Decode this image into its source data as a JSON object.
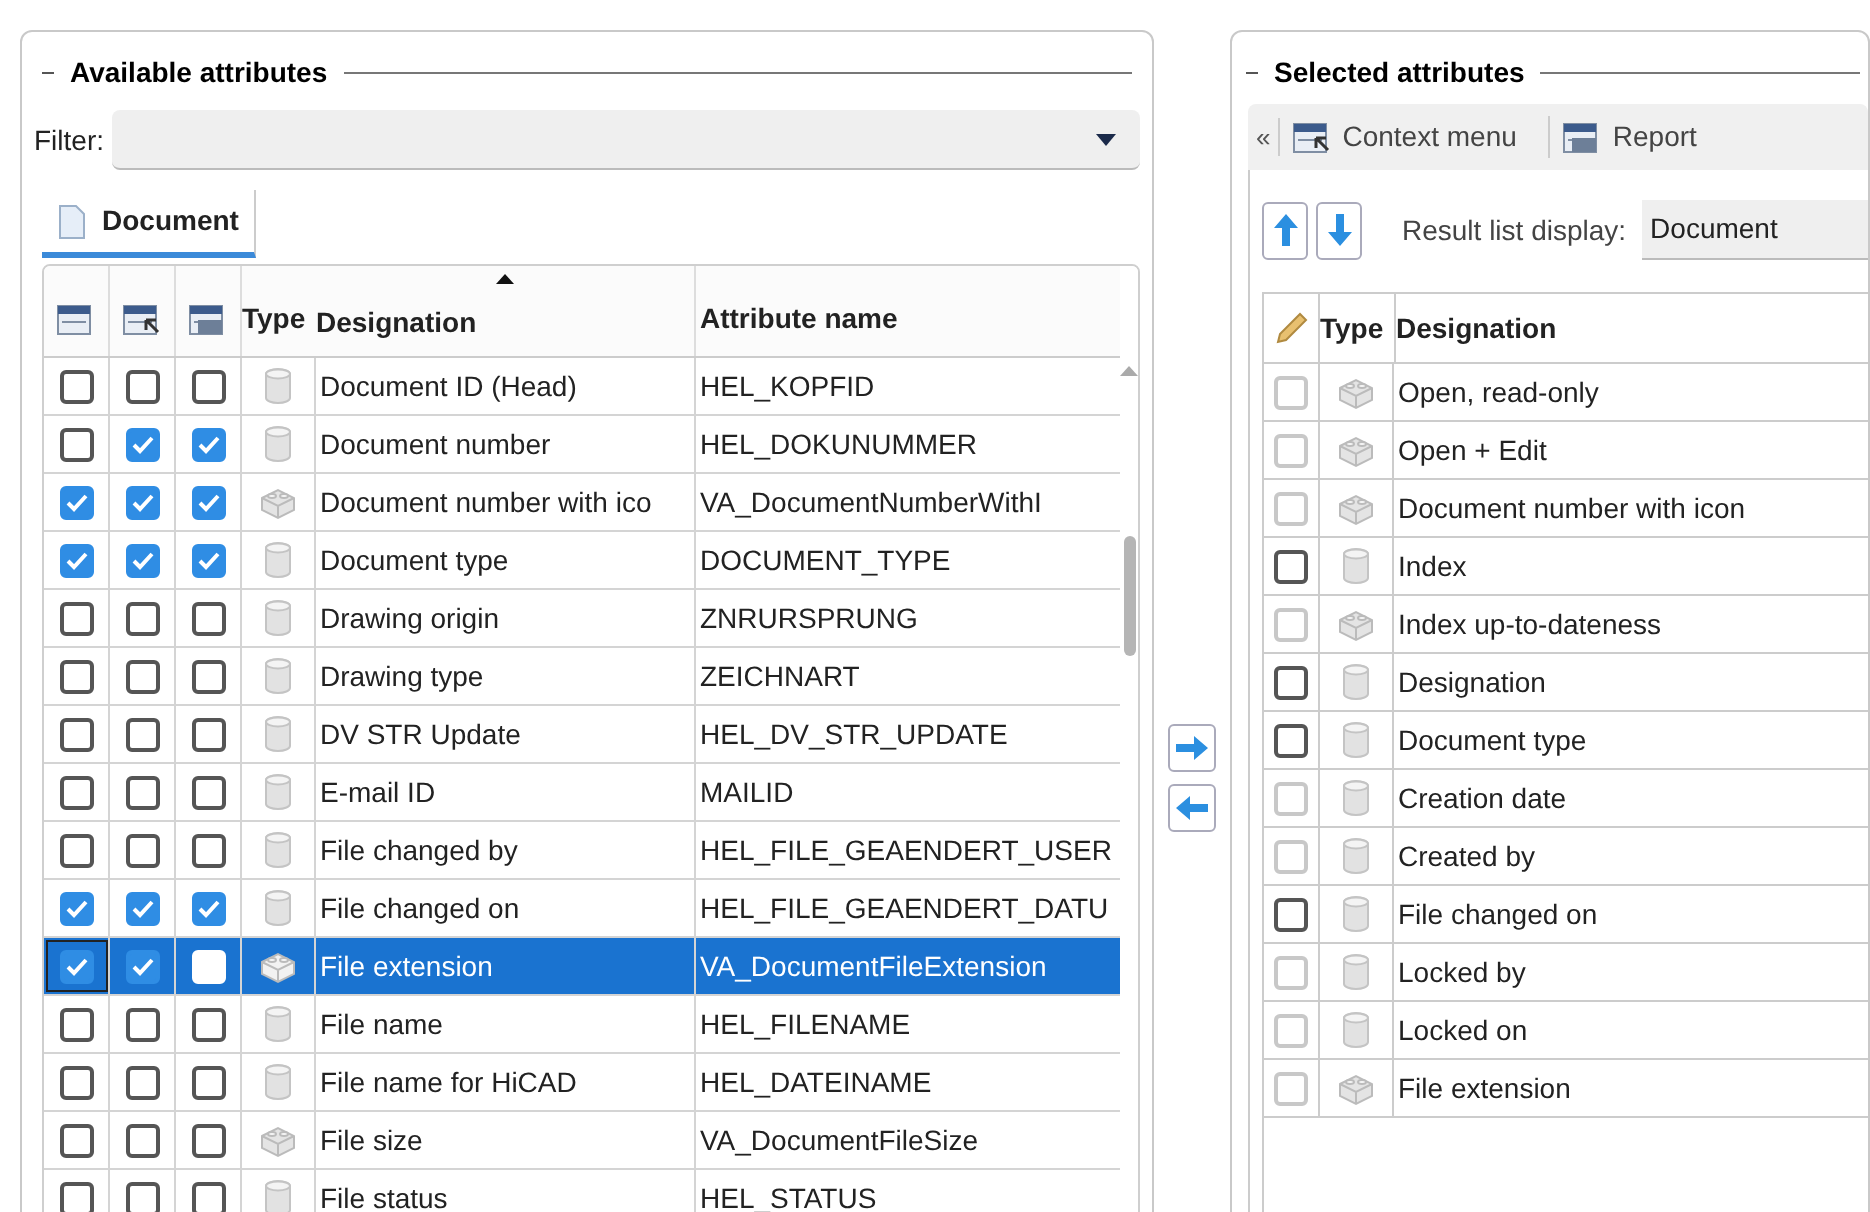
{
  "available": {
    "legend": "Available attributes",
    "filter": {
      "label": "Filter:"
    },
    "tab": {
      "label": "Document",
      "selected": true
    },
    "columns": [
      "Type",
      "Designation",
      "Attribute name"
    ],
    "rows": [
      {
        "display": false,
        "context": false,
        "report": false,
        "kind": "field",
        "designation": "Document ID (Head)",
        "attribute": "HEL_KOPFID",
        "selected": false
      },
      {
        "display": false,
        "context": true,
        "report": true,
        "kind": "field",
        "designation": "Document number",
        "attribute": "HEL_DOKUNUMMER",
        "selected": false
      },
      {
        "display": true,
        "context": true,
        "report": true,
        "kind": "virtual",
        "designation": "Document number with ico",
        "attribute": "VA_DocumentNumberWithI",
        "selected": false
      },
      {
        "display": true,
        "context": true,
        "report": true,
        "kind": "field",
        "designation": "Document type",
        "attribute": "DOCUMENT_TYPE",
        "selected": false
      },
      {
        "display": false,
        "context": false,
        "report": false,
        "kind": "field",
        "designation": "Drawing origin",
        "attribute": "ZNRURSPRUNG",
        "selected": false
      },
      {
        "display": false,
        "context": false,
        "report": false,
        "kind": "field",
        "designation": "Drawing type",
        "attribute": "ZEICHNART",
        "selected": false
      },
      {
        "display": false,
        "context": false,
        "report": false,
        "kind": "field",
        "designation": "DV STR Update",
        "attribute": "HEL_DV_STR_UPDATE",
        "selected": false
      },
      {
        "display": false,
        "context": false,
        "report": false,
        "kind": "field",
        "designation": "E-mail ID",
        "attribute": "MAILID",
        "selected": false
      },
      {
        "display": false,
        "context": false,
        "report": false,
        "kind": "field",
        "designation": "File changed by",
        "attribute": "HEL_FILE_GEAENDERT_USER",
        "selected": false
      },
      {
        "display": true,
        "context": true,
        "report": true,
        "kind": "field",
        "designation": "File changed on",
        "attribute": "HEL_FILE_GEAENDERT_DATU",
        "selected": false
      },
      {
        "display": true,
        "context": true,
        "report": false,
        "kind": "virtual",
        "designation": "File extension",
        "attribute": "VA_DocumentFileExtension",
        "selected": true
      },
      {
        "display": false,
        "context": false,
        "report": false,
        "kind": "field",
        "designation": "File name",
        "attribute": "HEL_FILENAME",
        "selected": false
      },
      {
        "display": false,
        "context": false,
        "report": false,
        "kind": "field",
        "designation": "File name for HiCAD",
        "attribute": "HEL_DATEINAME",
        "selected": false
      },
      {
        "display": false,
        "context": false,
        "report": false,
        "kind": "virtual",
        "designation": "File size",
        "attribute": "VA_DocumentFileSize",
        "selected": false
      },
      {
        "display": false,
        "context": false,
        "report": false,
        "kind": "field",
        "designation": "File status",
        "attribute": "HEL_STATUS",
        "selected": false
      }
    ]
  },
  "selected": {
    "legend": "Selected attributes",
    "collapse": "«",
    "toolbar": [
      {
        "label": "Context menu",
        "kind": "context"
      },
      {
        "label": "Report",
        "kind": "report"
      }
    ],
    "result_list_display": {
      "label": "Result list display:",
      "value": "Document"
    },
    "columns": [
      "Type",
      "Designation"
    ],
    "rows": [
      {
        "checked": false,
        "disabled": true,
        "kind": "virtual",
        "designation": "Open, read-only"
      },
      {
        "checked": false,
        "disabled": true,
        "kind": "virtual",
        "designation": "Open + Edit"
      },
      {
        "checked": false,
        "disabled": true,
        "kind": "virtual",
        "designation": "Document number with icon"
      },
      {
        "checked": false,
        "disabled": false,
        "kind": "field",
        "designation": "Index"
      },
      {
        "checked": false,
        "disabled": true,
        "kind": "virtual",
        "designation": "Index up-to-dateness"
      },
      {
        "checked": false,
        "disabled": false,
        "kind": "field",
        "designation": "Designation"
      },
      {
        "checked": false,
        "disabled": false,
        "kind": "field",
        "designation": "Document type"
      },
      {
        "checked": false,
        "disabled": true,
        "kind": "field",
        "designation": "Creation date"
      },
      {
        "checked": false,
        "disabled": true,
        "kind": "field",
        "designation": "Created by"
      },
      {
        "checked": false,
        "disabled": false,
        "kind": "field",
        "designation": "File changed on"
      },
      {
        "checked": false,
        "disabled": true,
        "kind": "field",
        "designation": "Locked by"
      },
      {
        "checked": false,
        "disabled": true,
        "kind": "field",
        "designation": "Locked on"
      },
      {
        "checked": false,
        "disabled": true,
        "kind": "virtual",
        "designation": "File extension"
      }
    ]
  }
}
